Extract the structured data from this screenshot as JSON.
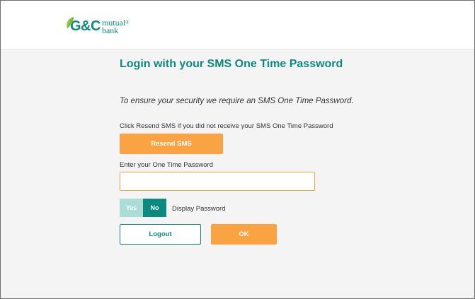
{
  "brand": {
    "logo_main": "G&C",
    "logo_word1": "mutual",
    "logo_word2": "bank",
    "logo_reg": "®",
    "leaf_icon": "leaf-icon",
    "brand_color": "#0b8a7e",
    "accent_color": "#f9a343"
  },
  "page": {
    "title": "Login with your SMS One Time Password",
    "intro": "To ensure your security we require an SMS One Time Password."
  },
  "resend": {
    "label": "Click Resend SMS if you did not receive your SMS One Time Password",
    "button_label": "Resend SMS"
  },
  "otp": {
    "label": "Enter your One Time Password",
    "value": "",
    "placeholder": ""
  },
  "display_password": {
    "yes_label": "Yes",
    "no_label": "No",
    "selected": "No",
    "label": "Display Password"
  },
  "actions": {
    "logout_label": "Logout",
    "ok_label": "OK"
  }
}
